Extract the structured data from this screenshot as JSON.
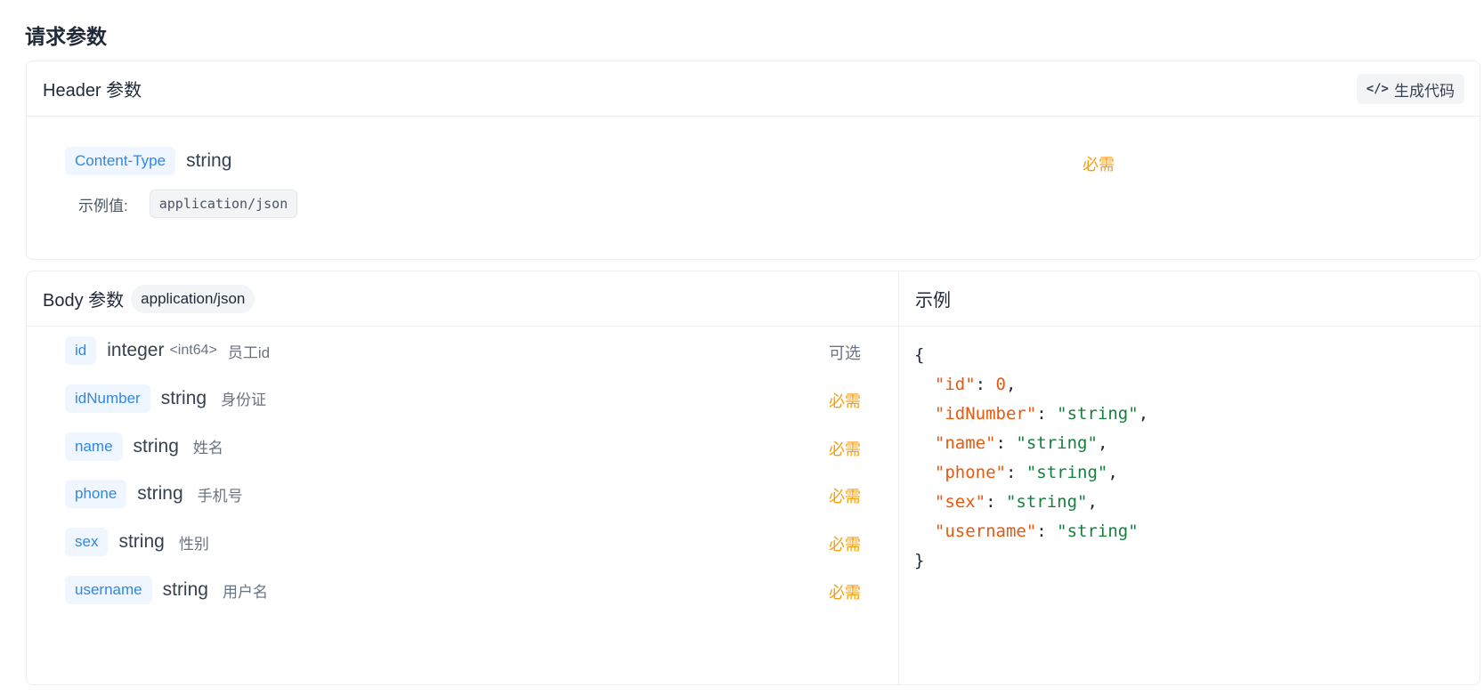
{
  "page_title": "请求参数",
  "header": {
    "title": "Header 参数",
    "gen_button": "生成代码",
    "param": {
      "name": "Content-Type",
      "type": "string",
      "required": "必需",
      "example_label": "示例值:",
      "example_value": "application/json"
    }
  },
  "body": {
    "title": "Body 参数",
    "content_type": "application/json",
    "example_title": "示例",
    "fields": [
      {
        "name": "id",
        "type": "integer",
        "format": "<int64>",
        "desc": "员工id",
        "status": "可选"
      },
      {
        "name": "idNumber",
        "type": "string",
        "format": "",
        "desc": "身份证",
        "status": "必需"
      },
      {
        "name": "name",
        "type": "string",
        "format": "",
        "desc": "姓名",
        "status": "必需"
      },
      {
        "name": "phone",
        "type": "string",
        "format": "",
        "desc": "手机号",
        "status": "必需"
      },
      {
        "name": "sex",
        "type": "string",
        "format": "",
        "desc": "性别",
        "status": "必需"
      },
      {
        "name": "username",
        "type": "string",
        "format": "",
        "desc": "用户名",
        "status": "必需"
      }
    ],
    "example_json": {
      "open": "{",
      "close": "}",
      "lines": [
        {
          "key": "\"id\"",
          "value": "0",
          "kind": "number",
          "comma": ","
        },
        {
          "key": "\"idNumber\"",
          "value": "\"string\"",
          "kind": "string",
          "comma": ","
        },
        {
          "key": "\"name\"",
          "value": "\"string\"",
          "kind": "string",
          "comma": ","
        },
        {
          "key": "\"phone\"",
          "value": "\"string\"",
          "kind": "string",
          "comma": ","
        },
        {
          "key": "\"sex\"",
          "value": "\"string\"",
          "kind": "string",
          "comma": ","
        },
        {
          "key": "\"username\"",
          "value": "\"string\"",
          "kind": "string",
          "comma": ""
        }
      ]
    }
  },
  "colors": {
    "tag_text": "#2f88e0",
    "tag_bg": "#eff6ff",
    "required": "#f59e0b",
    "json_key": "#ea580c",
    "json_string": "#15803d"
  }
}
